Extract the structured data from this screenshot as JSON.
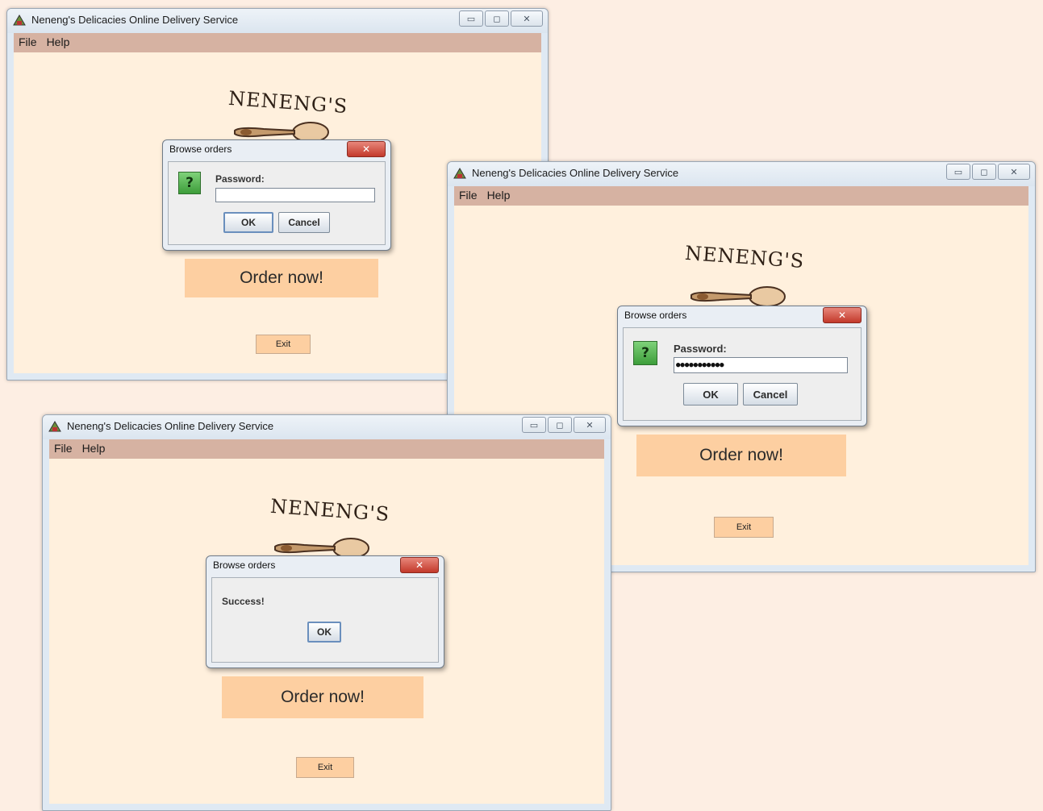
{
  "window_title": "Neneng's Delicacies Online Delivery Service",
  "menu": {
    "file": "File",
    "help": "Help"
  },
  "logo": {
    "text": "NENENG'S"
  },
  "main": {
    "order_label": "Order now!",
    "exit_label": "Exit"
  },
  "window_controls": {
    "minimize": "▭",
    "maximize": "◻",
    "close": "✕"
  },
  "dialog_password_empty": {
    "title": "Browse orders",
    "question_icon": "?",
    "prompt_label": "Password:",
    "password_value": "",
    "ok_label": "OK",
    "cancel_label": "Cancel",
    "close_label": "✕"
  },
  "dialog_password_filled": {
    "title": "Browse orders",
    "question_icon": "?",
    "prompt_label": "Password:",
    "password_value": "●●●●●●●●●●●",
    "ok_label": "OK",
    "cancel_label": "Cancel",
    "close_label": "✕"
  },
  "dialog_success": {
    "title": "Browse orders",
    "message": "Success!",
    "ok_label": "OK",
    "close_label": "✕"
  },
  "colors": {
    "background": "#fdeee3",
    "menubar": "#d6b2a2",
    "content": "#fff0dd",
    "order_button": "#fdcfa1"
  }
}
